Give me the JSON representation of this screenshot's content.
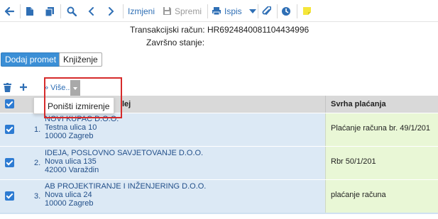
{
  "toolbar": {
    "izmijeni_label": "Izmjeni",
    "spremi_label": "Spremi",
    "ispis_label": "Ispis"
  },
  "account": {
    "transakcijski_label": "Transakcijski račun:",
    "transakcijski_value": "HR6924840081104434996",
    "zavrsno_label": "Završno stanje:",
    "zavrsno_value": ""
  },
  "actions": {
    "dodaj_promet": "Dodaj promet",
    "knjizenje": "Knjiženje"
  },
  "table_toolbar": {
    "vise_label": "Više..."
  },
  "dropdown": {
    "items": [
      "Poništi izmirenje"
    ]
  },
  "table": {
    "header_partner_fragment": "lej",
    "header_purpose": "Svrha plaćanja",
    "rows": [
      {
        "num": "1.",
        "name": "NOVI KUPAC D.O.O.",
        "street": "Testna ulica 10",
        "city": "10000 Zagreb",
        "purpose": "Plaćanje računa br. 49/1/201",
        "checked": true
      },
      {
        "num": "2.",
        "name": "IDEJA, POSLOVNO SAVJETOVANJE D.O.O.",
        "street": "Nova ulica 135",
        "city": "42000 Varaždin",
        "purpose": "Rbr 50/1/201",
        "checked": true
      },
      {
        "num": "3.",
        "name": "AB PROJEKTIRANJE I INŽENJERING D.O.O.",
        "street": "Nova ulica 24",
        "city": "10000 Zagreb",
        "purpose": "plaćanje računa",
        "checked": true
      }
    ]
  },
  "colors": {
    "accent": "#2f6fb5",
    "primary_button": "#3b8fd6",
    "row_bg": "#dce9f5",
    "purpose_bg": "#e9f7d6",
    "highlight_border": "#d62b2b",
    "note_icon": "#f5e63a"
  }
}
